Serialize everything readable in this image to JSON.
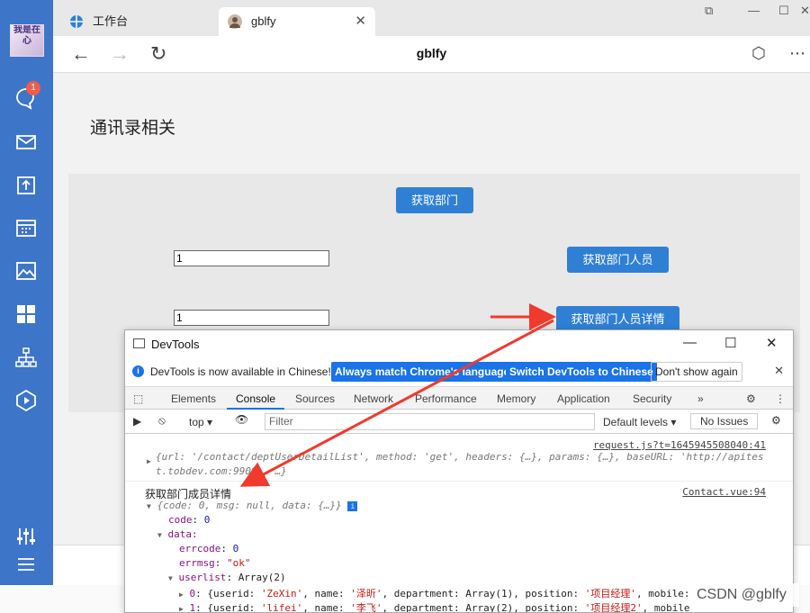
{
  "sidebar": {
    "avatar_text": "我是在心",
    "badge": "1",
    "icons": [
      "chat-icon",
      "mail-icon",
      "cube-icon",
      "calendar-icon",
      "image-icon",
      "apps-icon",
      "org-icon",
      "video-icon",
      "equalizer-icon",
      "menu-icon"
    ]
  },
  "browser": {
    "tabs": [
      {
        "label": "工作台",
        "active": false
      },
      {
        "label": "gblfy",
        "active": true
      }
    ],
    "address_title": "gblfy"
  },
  "page": {
    "title": "通讯录相关",
    "btn_get_dept": "获取部门",
    "input1_value": "1",
    "btn_get_dept_members": "获取部门人员",
    "input2_value": "1",
    "btn_get_member_details": "获取部门人员详情"
  },
  "devtools": {
    "title": "DevTools",
    "info_msg": "DevTools is now available in Chinese!",
    "btn_match": "Always match Chrome's language",
    "btn_switch": "Switch DevTools to Chinese",
    "btn_dont_show": "Don't show again",
    "tabs": [
      "Elements",
      "Console",
      "Sources",
      "Network",
      "Performance",
      "Memory",
      "Application",
      "Security"
    ],
    "more_tabs": "»",
    "context": "top",
    "filter_placeholder": "Filter",
    "levels": "Default levels",
    "issues": "No Issues",
    "console": {
      "src1": "request.js?t=1645945508040:41",
      "log1_a": "{url: ",
      "log1_url": "'/contact/deptUserDetailList'",
      "log1_b": ", method: ",
      "log1_method": "'get'",
      "log1_c": ", headers: {…}, params: {…}, baseURL: ",
      "log1_base": "'http://apites",
      "log1_base2": "t.tobdev.com:9900'",
      "log1_d": ", …}",
      "label2": "获取部门成员详情",
      "src2": "Contact.vue:94",
      "log2": "{code: 0, msg: null, data: {…}}",
      "code_key": "code",
      "code_val": "0",
      "data_key": "data:",
      "errcode_key": "errcode",
      "errcode_val": "0",
      "errmsg_key": "errmsg",
      "errmsg_val": "\"ok\"",
      "userlist_key": "userlist",
      "userlist_val": "Array(2)",
      "u0_idx": "0",
      "u0_a": "{userid: ",
      "u0_id": "'ZeXin'",
      "u0_b": ", name: ",
      "u0_name": "'泽昕'",
      "u0_c": ", department: Array(1), position: ",
      "u0_pos": "'项目经理'",
      "u0_d": ", mobile: ",
      "u1_idx": "1",
      "u1_a": "{userid: ",
      "u1_id": "'lifei'",
      "u1_b": ", name: ",
      "u1_name": "'李飞'",
      "u1_c": ", department: Array(2), position: ",
      "u1_pos": "'项目经理2'",
      "u1_d": ", mobile"
    }
  },
  "watermark": "CSDN @gblfy",
  "colors": {
    "sidebar": "#3d76c8",
    "button": "#2f80d4",
    "arrow": "#f03a2e",
    "devtools_accent": "#1a73e8"
  }
}
